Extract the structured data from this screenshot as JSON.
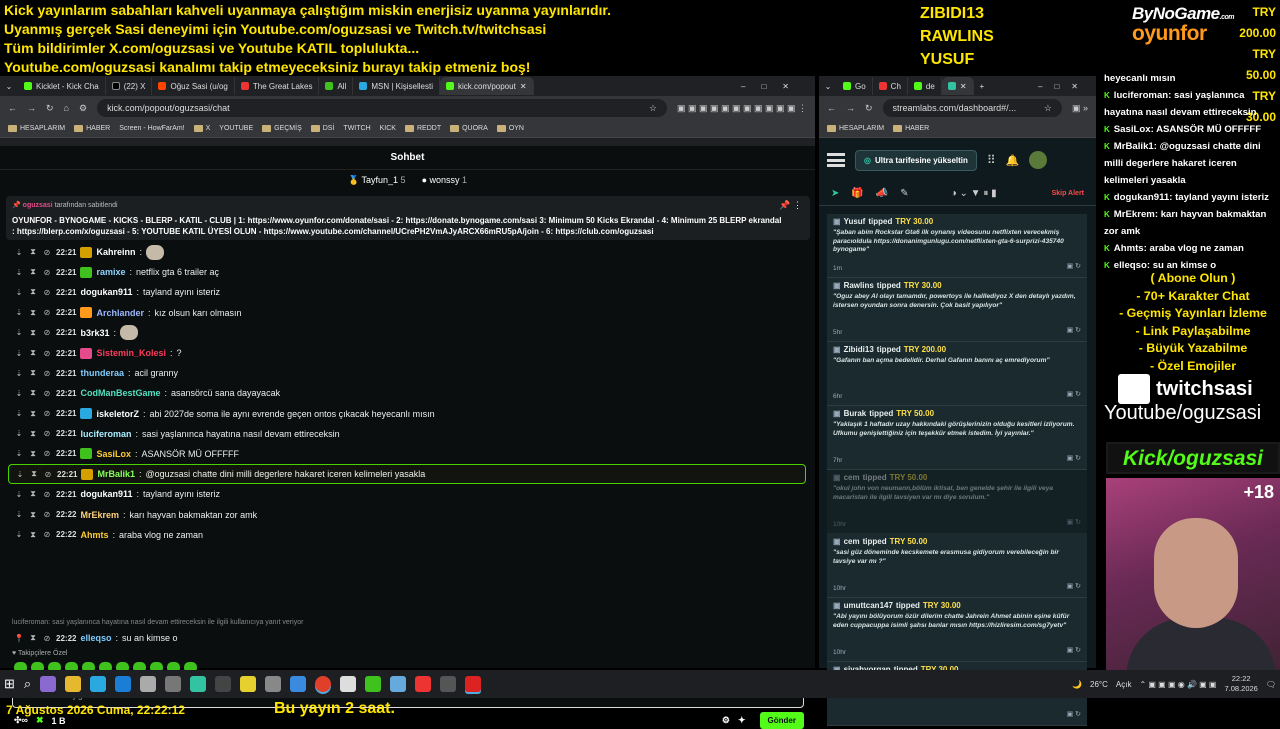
{
  "banner": {
    "lines": [
      "Kick yayınlarım sabahları kahveli uyanmaya çalıştığım miskin enerjisiz uyanma yayınlarıdır.",
      "Uyanmış gerçek Sasi deneyimi için Youtube.com/oguzsasi ve Twitch.tv/twitchsasi",
      "Tüm bildirimler X.com/oguzsasi ve Youtube KATIL toplulukta...",
      "Youtube.com/oguzsasi kanalımı takip etmeyeceksiniz burayı takip etmeniz boş!"
    ]
  },
  "donors": [
    "ZIBIDI13",
    "RAWLINS",
    "YUSUF"
  ],
  "brand": {
    "top": "ByNoGame",
    "bottom": "oyunfor",
    "com": ".com"
  },
  "amounts": [
    "TRY 200.00",
    "TRY 50.00",
    "TRY 30.00"
  ],
  "left_browser": {
    "tabs": [
      "Kicklet - Kick Cha",
      "(22) X",
      "Oğuz Sasi (u/og",
      "The Great Lakes",
      "All",
      "MSN | Kişisellesti",
      "kick.com/popout"
    ],
    "url": "kick.com/popout/oguzsasi/chat",
    "bookmarks": [
      "HESAPLARIM",
      "HABER",
      "Screen - HowFarAm!",
      "X",
      "YOUTUBE",
      "GEÇMİŞ",
      "DSİ",
      "TWITCH",
      "KICK",
      "REDDT",
      "QUORA",
      "OYN"
    ]
  },
  "chat": {
    "title": "Sohbet",
    "leaders": [
      {
        "name": "Tayfun_1",
        "count": "5"
      },
      {
        "name": "wonssy",
        "count": "1"
      }
    ],
    "pinned": {
      "by": "oguzsasi",
      "by_suffix": " tarafından sabitlendi",
      "text": "OYUNFOR - BYNOGAME - KICKS - BLERP - KATIL - CLUB | 1: https://www.oyunfor.com/donate/sasi - 2: https://donate.bynogame.com/sasi 3: Minimum 50 Kicks Ekrandal - 4: Minimum 25 BLERP ekrandal : https://blerp.com/x/oguzsasi - 5: YOUTUBE KATIL ÜYESİ OLUN - https://www.youtube.com/channel/UCrePH2VmAJyARCX66mRU5pA/join - 6: https://club.com/oguzsasi"
    },
    "messages": [
      {
        "time": "22:21",
        "user": "Kahreinn",
        "color": "#fff",
        "text": "",
        "emote": true,
        "badge": "#d4a000"
      },
      {
        "time": "22:21",
        "user": "ramixe",
        "color": "#8fd3ff",
        "text": "netflix gta 6 trailer aç",
        "badge": "#3fc21e"
      },
      {
        "time": "22:21",
        "user": "dogukan911",
        "color": "#fff",
        "text": "tayland ayını isteriz"
      },
      {
        "time": "22:21",
        "user": "Archlander",
        "color": "#9bb8ff",
        "text": "kız olsun karı olmasın",
        "badge": "#ff9a1a"
      },
      {
        "time": "22:21",
        "user": "b3rk31",
        "color": "#fff",
        "text": "",
        "emote": true
      },
      {
        "time": "22:21",
        "user": "Sistemin_Kolesi",
        "color": "#ff3b5c",
        "text": "?",
        "badge": "#e34b8a"
      },
      {
        "time": "22:21",
        "user": "thunderaa",
        "color": "#7ecbff",
        "text": "acil granny"
      },
      {
        "time": "22:21",
        "user": "CodManBestGame",
        "color": "#53e0c0",
        "text": "asansörcü sana dayayacak"
      },
      {
        "time": "22:21",
        "user": "iskeletorZ",
        "color": "#fff",
        "text": "abi 2027de soma ile aynı evrende geçen ontos çıkacak heyecanlı mısın",
        "badge": "#2aa8e0"
      },
      {
        "time": "22:21",
        "user": "luciferoman",
        "color": "#aef",
        "text": "sasi yaşlanınca hayatına nasıl devam ettireceksin"
      },
      {
        "time": "22:21",
        "user": "SasiLox",
        "color": "#ffcc33",
        "text": "ASANSÖR MÜ OFFFFF",
        "badge": "#3fc21e"
      },
      {
        "time": "22:21",
        "user": "MrBalik1",
        "color": "#8aff5a",
        "text": "@oguzsasi chatte dini milli degerlere hakaret iceren kelimeleri yasakla",
        "badge": "#d4a000",
        "hl": true
      },
      {
        "time": "22:21",
        "user": "dogukan911",
        "color": "#fff",
        "text": "tayland ayını isteriz"
      },
      {
        "time": "22:22",
        "user": "MrEkrem",
        "color": "#ffd27a",
        "text": "karı hayvan bakmaktan zor amk"
      },
      {
        "time": "22:22",
        "user": "Ahmts",
        "color": "#ffcc33",
        "text": "araba vlog ne zaman"
      }
    ],
    "reply_hint": "luciferoman: sasi yaşlanınca hayatına nasıl devam ettireceksin ile ilgili kullanıcıya yanıt veriyor",
    "last": {
      "time": "22:22",
      "user": "elleqso",
      "color": "#7ecbff",
      "text": "su an kimse o"
    },
    "followers_label": "Takipçilere Özel",
    "input_placeholder": "Bir mesaj gönderin",
    "kicks": "1 B",
    "send_label": "Gönder"
  },
  "right_browser": {
    "url": "streamlabs.com/dashboard#/...",
    "bookmarks": [
      "HESAPLARIM",
      "HABER"
    ],
    "upgrade": "Ultra tarifesine yükseltin",
    "skip": "Skip Alert",
    "tips": [
      {
        "name": "Yusuf",
        "amount": "TRY 30.00",
        "msg": "\"Şaban abim Rockstar Gta6 ilk oynanış videosunu netflixten verecekmiş paracıoldula https://donanimgunlugu.com/netflixten-gta-6-surprizi-435740 bynogame\"",
        "ago": "1m"
      },
      {
        "name": "Rawlins",
        "amount": "TRY 30.00",
        "msg": "\"Oguz abey AI olayı tamamdır, powertoys ile halllediyoz X den detaylı yazdım, istersen oyundan sonra denersin. Çok basit yapılıyor\"",
        "ago": "5hr"
      },
      {
        "name": "Zibidi13",
        "amount": "TRY 200.00",
        "msg": "\"Gafanın ban açma bedelidir. Derhal Gafanın banını aç emrediyorum\"",
        "ago": "6hr"
      },
      {
        "name": "Burak",
        "amount": "TRY 50.00",
        "msg": "\"Yaklaşık 1 haftadır uzay hakkındaki görüşlerinizin olduğu kesitleri izliyorum. Ufkumu genişlettiğiniz için teşekkür etmek istedim. İyi yayınlar.\"",
        "ago": "7hr"
      },
      {
        "name": "cem",
        "amount": "TRY 50.00",
        "msg": "\"okul john von neumann,bölüm iktisat, ben genelde şehir ile ilgili veya macaristan ile ilgili tavsiyen var mı diye sorulum.\"",
        "ago": "10hr",
        "dim": true
      },
      {
        "name": "cem",
        "amount": "TRY 50.00",
        "msg": "\"sasi güz döneminde kecskemete erasmusa gidiyorum verebileceğin bir tavsiye var mı ?\"",
        "ago": "10hr"
      },
      {
        "name": "umuttcan147",
        "amount": "TRY 30.00",
        "msg": "\"Abi yayını bölüyorum özür dilerim chatte Jahrein Ahmet abinin eşine küfür eden cuppacuppa isimli şahsı banlar mısın https://hizliresim.com/sg7yetv\"",
        "ago": "10hr"
      },
      {
        "name": "siyahyorgan",
        "amount": "TRY 30.00",
        "msg": "\"Normalde film ve dizileri izleyemem dikkatim çok dağılır ama bu dizi beni çok sardı dün başladım 8 bölümü kadar gittim. Herhangi dizi bir sev",
        "ago": ""
      }
    ],
    "tipped_word": "tipped"
  },
  "overlay": {
    "chat": [
      {
        "user": "",
        "text": "heyecanlı mısın"
      },
      {
        "user": "luciferoman",
        "text": "sasi yaşlanınca hayatına nasıl devam ettireceksin"
      },
      {
        "user": "SasiLox",
        "text": "ASANSÖR MÜ OFFFFF"
      },
      {
        "user": "MrBalik1",
        "text": "@oguzsasi chatte dini milli degerlere hakaret iceren kelimeleri yasakla"
      },
      {
        "user": "dogukan911",
        "text": "tayland yayını isteriz"
      },
      {
        "user": "MrEkrem",
        "text": "karı hayvan bakmaktan zor amk"
      },
      {
        "user": "Ahmts",
        "text": "araba vlog ne zaman"
      },
      {
        "user": "elleqso",
        "text": "su an kimse o"
      }
    ],
    "abone": [
      "( Abone Olun )",
      "- 70+ Karakter Chat",
      "- Geçmiş Yayınları İzleme",
      "- Link Paylaşabilme",
      "- Büyük Yazabilme",
      "- Özel Emojiler"
    ],
    "twitch": "twitchsasi",
    "youtube": "Youtube/oguzsasi",
    "kick": "Kick/oguzsasi",
    "viewers": "+18"
  },
  "taskbar": {
    "weather": "26°C",
    "weather_label": "Açık",
    "time": "22:22",
    "date": "7.08.2026"
  },
  "footer": {
    "date": "7 Ağustos 2026 Cuma, 22:22:12",
    "message": "Bu yayın 2 saat."
  }
}
